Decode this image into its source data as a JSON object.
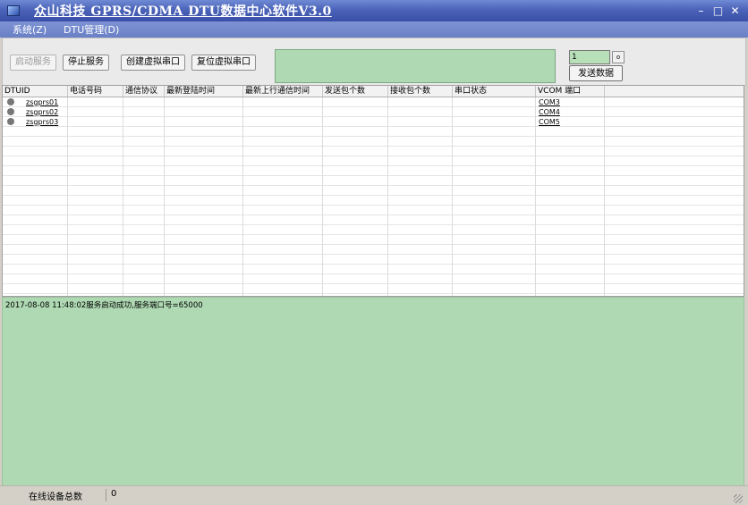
{
  "window": {
    "title": "众山科技 GPRS/CDMA DTU数据中心软件V3.0",
    "controls": {
      "minimize": "–",
      "maximize": "□",
      "close": "✕"
    }
  },
  "menu": [
    {
      "label": "系统(Z)"
    },
    {
      "label": "DTU管理(D)"
    }
  ],
  "toolbar": {
    "start_service": "启动服务",
    "stop_service": "停止服务",
    "create_vport": "创建虚拟串口",
    "reset_vport": "复位虚拟串口",
    "port_number_value": "1",
    "spin_icon": "o",
    "send_data": "发送数据"
  },
  "table": {
    "columns": [
      {
        "label": "DTUID"
      },
      {
        "label": "电话号码"
      },
      {
        "label": "通信协议"
      },
      {
        "label": "最新登陆时间"
      },
      {
        "label": "最新上行通信时间"
      },
      {
        "label": "发送包个数"
      },
      {
        "label": "接收包个数"
      },
      {
        "label": "串口状态"
      },
      {
        "label": "VCOM 端口"
      }
    ],
    "rows": [
      {
        "dtuid": "zsgprs01",
        "vcom": "COM3"
      },
      {
        "dtuid": "zsgprs02",
        "vcom": "COM4"
      },
      {
        "dtuid": "zsgprs03",
        "vcom": "COM5"
      }
    ]
  },
  "log": {
    "lines": [
      "2017-08-08 11:48:02服务启动成功,服务端口号=65000"
    ]
  },
  "status": {
    "online_label": "在线设备总数",
    "online_count": "0"
  },
  "colors": {
    "title_bar": "#4b63b8",
    "menu_bar": "#6a80c6",
    "green_panel": "#aed9b2",
    "status_dot_offline": "#777777"
  }
}
